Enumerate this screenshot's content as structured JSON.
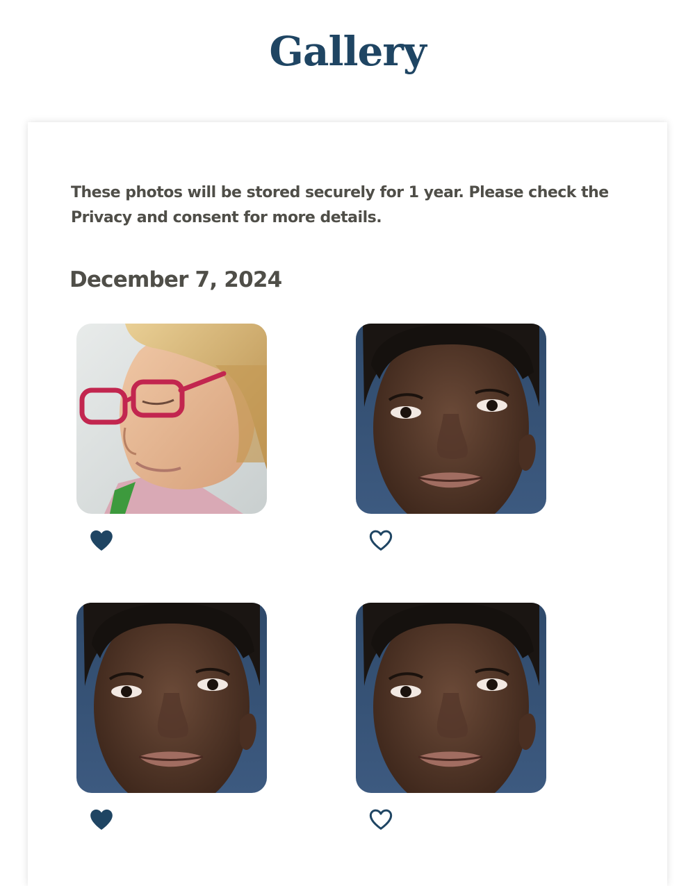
{
  "header": {
    "title": "Gallery"
  },
  "gallery": {
    "notice": "These photos will be stored securely for 1 year. Please check the Privacy and consent for more details.",
    "date_heading": "December 7, 2024",
    "photos": [
      {
        "subject": "older woman with red glasses and blonde hair",
        "favorited": true,
        "icon": "heart-filled-icon"
      },
      {
        "subject": "young woman portrait",
        "favorited": false,
        "icon": "heart-outline-icon"
      },
      {
        "subject": "young woman portrait",
        "favorited": true,
        "icon": "heart-filled-icon"
      },
      {
        "subject": "young woman portrait",
        "favorited": false,
        "icon": "heart-outline-icon"
      }
    ]
  },
  "colors": {
    "brand": "#1f4563",
    "text": "#4f4e48",
    "background": "#ffffff"
  }
}
